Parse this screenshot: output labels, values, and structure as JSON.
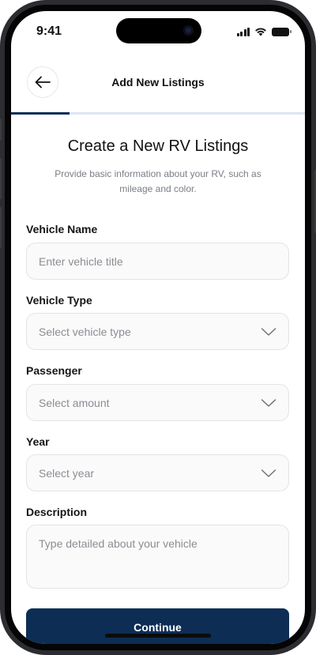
{
  "status": {
    "time": "9:41"
  },
  "header": {
    "title": "Add New Listings"
  },
  "progress": {
    "fraction": 0.2
  },
  "intro": {
    "title": "Create a New RV Listings",
    "subtitle": "Provide basic information about your RV, such as mileage and color."
  },
  "form": {
    "vehicle_name": {
      "label": "Vehicle Name",
      "placeholder": "Enter vehicle title"
    },
    "vehicle_type": {
      "label": "Vehicle Type",
      "placeholder": "Select vehicle type"
    },
    "passenger": {
      "label": "Passenger",
      "placeholder": "Select amount"
    },
    "year": {
      "label": "Year",
      "placeholder": "Select year"
    },
    "description": {
      "label": "Description",
      "placeholder": "Type detailed about your vehicle"
    }
  },
  "actions": {
    "continue_label": "Continue"
  },
  "colors": {
    "primary": "#0d2d55",
    "track": "#dde5f3",
    "field_bg": "#fafafa",
    "placeholder": "#8a8d93"
  },
  "icons": [
    "back-arrow-icon",
    "chevron-down-icon",
    "signal-icon",
    "wifi-icon",
    "battery-icon"
  ]
}
